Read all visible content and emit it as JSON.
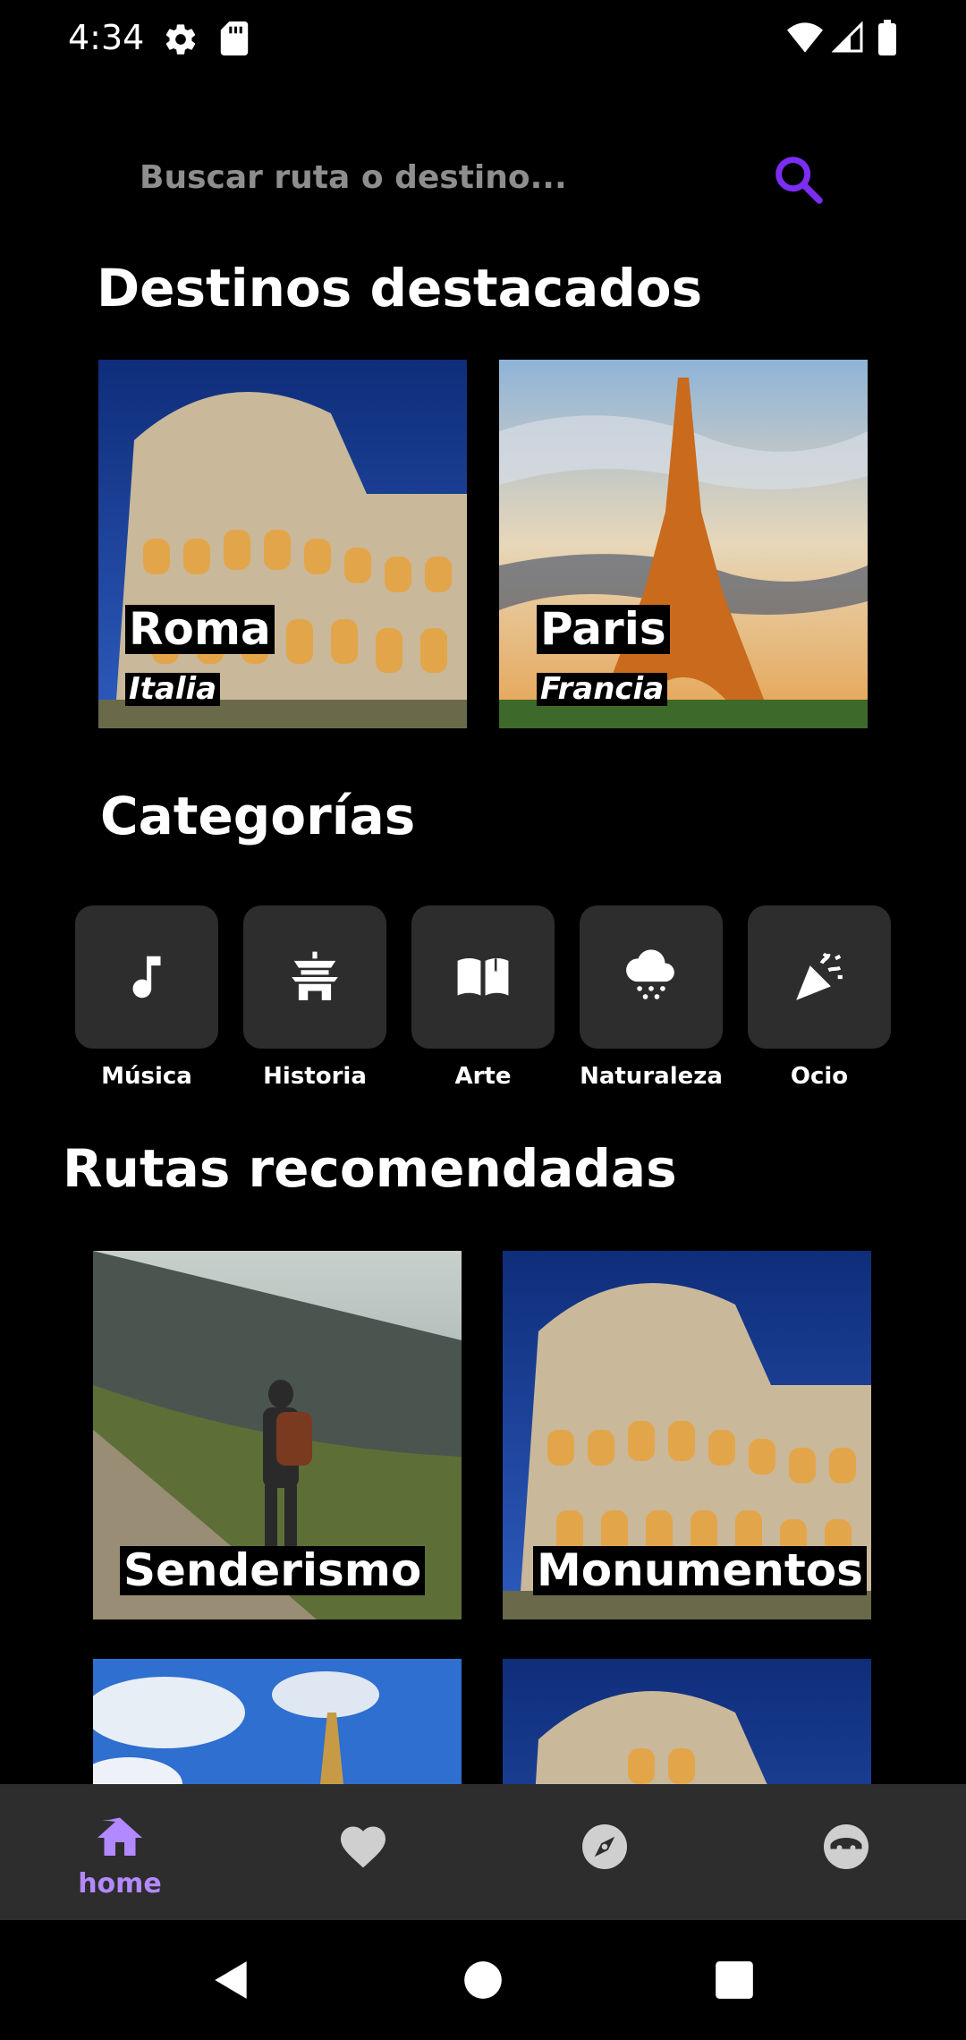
{
  "status_bar": {
    "time": "4:34"
  },
  "search": {
    "placeholder": "Buscar ruta o destino..."
  },
  "featured": {
    "title": "Destinos destacados",
    "cards": [
      {
        "city": "Roma",
        "country": "Italia"
      },
      {
        "city": "Paris",
        "country": "Francia"
      }
    ]
  },
  "categories": {
    "title": "Categorías",
    "items": [
      {
        "label": "Música",
        "icon": "music-note-icon"
      },
      {
        "label": "Historia",
        "icon": "pagoda-icon"
      },
      {
        "label": "Arte",
        "icon": "book-icon"
      },
      {
        "label": "Naturaleza",
        "icon": "snow-cloud-icon"
      },
      {
        "label": "Ocio",
        "icon": "party-popper-icon"
      }
    ]
  },
  "routes": {
    "title": "Rutas recomendadas",
    "cards": [
      {
        "label": "Senderismo"
      },
      {
        "label": "Monumentos"
      }
    ]
  },
  "bottom_nav": {
    "items": [
      {
        "label": "home",
        "icon": "home-icon",
        "active": true
      },
      {
        "icon": "heart-icon"
      },
      {
        "icon": "compass-icon"
      },
      {
        "icon": "profile-icon"
      }
    ]
  },
  "colors": {
    "accent": "#b389ff",
    "search_icon": "#7c2df2",
    "tile": "#2d2d2d",
    "nav_bar": "#2d2d2d"
  }
}
